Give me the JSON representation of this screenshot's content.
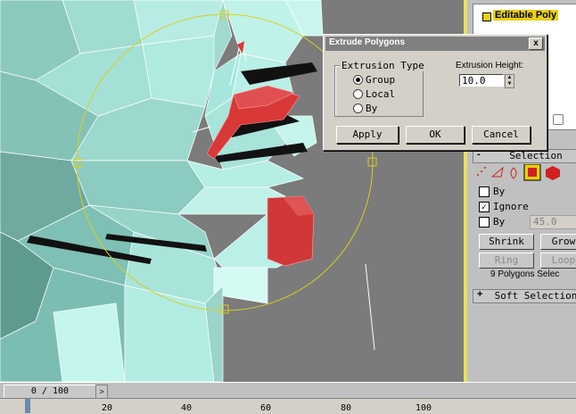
{
  "dialog": {
    "title": "Extrude Polygons",
    "close_glyph": "x",
    "extrusion_type_label": "Extrusion Type",
    "options": [
      "Group",
      "Local",
      "By"
    ],
    "selected_option": "Group",
    "height_label": "Extrusion Height:",
    "height_value": "10.0",
    "apply_label": "Apply",
    "ok_label": "OK",
    "cancel_label": "Cancel"
  },
  "modifier_stack": {
    "item_label": "Editable Poly"
  },
  "selection_rollout": {
    "toggle": "-",
    "title": "Selection",
    "by_vertex_label": "By",
    "ignore_label": "Ignore",
    "by_angle_label": "By",
    "angle_value": "45.0",
    "ignore_checked": true,
    "shrink_label": "Shrink",
    "grow_label": "Grow",
    "ring_label": "Ring",
    "loop_label": "Loop",
    "status": "9 Polygons Selec"
  },
  "soft_selection": {
    "toggle": "+",
    "title": "Soft Selection"
  },
  "timeline": {
    "frame_text": "0 / 100",
    "arrow": ">",
    "ticks": [
      "20",
      "40",
      "60",
      "80",
      "100"
    ]
  },
  "colors": {
    "mesh": "#a8ece0",
    "selected": "#d83838",
    "gizmo": "#d8d020",
    "viewport_bg": "#7b7b7b"
  }
}
